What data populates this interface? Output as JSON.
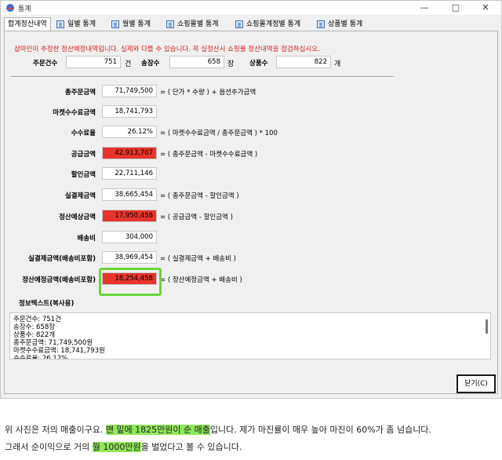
{
  "window": {
    "title": "통계",
    "tabs": [
      {
        "label": "합계정산내역",
        "active": true,
        "icon": ""
      },
      {
        "label": "일별 통계",
        "active": false,
        "icon": "table-icon"
      },
      {
        "label": "월별 통계",
        "active": false,
        "icon": "table-icon"
      },
      {
        "label": "쇼핑몰별 통계",
        "active": false,
        "icon": "table-icon"
      },
      {
        "label": "쇼핑몰계정별 통계",
        "active": false,
        "icon": "table-icon"
      },
      {
        "label": "상품별 통계",
        "active": false,
        "icon": "table-icon"
      }
    ]
  },
  "notice": "샵마인이 추정한 정산예정내역입니다. 실제와 다를 수 있습니다. 꼭 실정산시 쇼핑몰 정산내역을 점검하십시오.",
  "counts": {
    "orders_label": "주문건수",
    "orders_value": "751",
    "orders_unit": "건",
    "invoices_label": "송장수",
    "invoices_value": "658",
    "invoices_unit": "장",
    "products_label": "상품수",
    "products_value": "822",
    "products_unit": "개"
  },
  "rows": [
    {
      "label": "총주문금액",
      "value": "71,749,500",
      "highlight": false,
      "formula": "= ( 단가  *  수량 ) + 옵션추가금액"
    },
    {
      "label": "마켓수수료금액",
      "value": "18,741,793",
      "highlight": false,
      "formula": ""
    },
    {
      "label": "수수료율",
      "value": "26.12%",
      "highlight": false,
      "formula": "= ( 마켓수수료금액  /  총주문금액 ) * 100"
    },
    {
      "label": "공급금액",
      "value": "42,913,707",
      "highlight": true,
      "formula": "= ( 총주문금액  -  마켓수수료금액 )"
    },
    {
      "label": "할인금액",
      "value": "22,711,146",
      "highlight": false,
      "formula": ""
    },
    {
      "label": "실결제금액",
      "value": "38,665,454",
      "highlight": false,
      "formula": "= ( 총주문금액  -  할인금액 )"
    },
    {
      "label": "정산예상금액",
      "value": "17,950,458",
      "highlight": true,
      "formula": "= ( 공급금액  -  할인금액 )"
    },
    {
      "label": "배송비",
      "value": "304,000",
      "highlight": false,
      "formula": ""
    },
    {
      "label": "실결제금액(배송비포함)",
      "value": "38,969,454",
      "highlight": false,
      "formula": "= (  실결제금액   +  배송비 )"
    },
    {
      "label": "정산예정금액(배송비포함)",
      "value": "18,254,458",
      "highlight": true,
      "formula": "= (  정산예정금액   +  배송비 )"
    }
  ],
  "info": {
    "title": "정보텍스트(복사용)",
    "lines": [
      "주문건수: 751건",
      "송장수: 658장",
      "상품수: 822개",
      "총주문금액: 71,749,500원",
      "마켓수수료금액: 18,741,793원",
      "수수료율: 26.12%"
    ]
  },
  "close_button": "닫기(C)",
  "blog": {
    "line1_a": "위 사진은 저의 매출이구요. ",
    "line1_hl": "맨 밑에 1825만원이 순 매출",
    "line1_b": "입니다. 제가 마진률이 매우 높아 마진이 60%가 좀 넘습니다.",
    "line2_a": "그래서 순이익으로 거의 ",
    "line2_hl": "월 1000만원",
    "line2_b": "을 벌었다고 볼 수 있습니다."
  },
  "colors": {
    "highlight_red": "#e8342c",
    "annotation_green": "#6ad53a",
    "notice_red": "#d42020"
  }
}
